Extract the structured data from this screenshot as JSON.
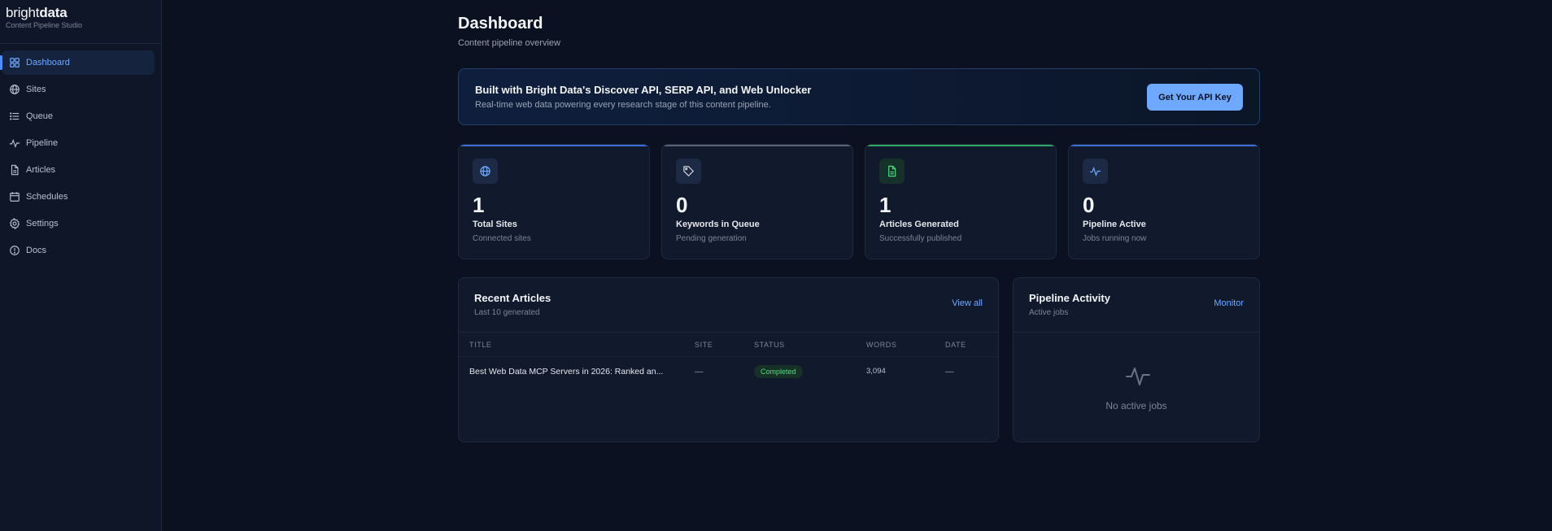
{
  "brand": {
    "logo_light": "bright",
    "logo_bold": "data",
    "subtitle": "Content Pipeline Studio"
  },
  "sidebar": {
    "items": [
      {
        "label": "Dashboard",
        "icon": "grid-icon",
        "active": true
      },
      {
        "label": "Sites",
        "icon": "globe-icon"
      },
      {
        "label": "Queue",
        "icon": "list-icon"
      },
      {
        "label": "Pipeline",
        "icon": "activity-icon"
      },
      {
        "label": "Articles",
        "icon": "file-icon"
      },
      {
        "label": "Schedules",
        "icon": "calendar-icon"
      },
      {
        "label": "Settings",
        "icon": "gear-icon"
      },
      {
        "label": "Docs",
        "icon": "info-icon"
      }
    ]
  },
  "header": {
    "title": "Dashboard",
    "subtitle": "Content pipeline overview"
  },
  "banner": {
    "title": "Built with Bright Data's Discover API, SERP API, and Web Unlocker",
    "text": "Real-time web data powering every research stage of this content pipeline.",
    "button_label": "Get Your API Key"
  },
  "stats": [
    {
      "value": "1",
      "label": "Total Sites",
      "sub": "Connected sites",
      "icon": "globe-icon",
      "accent": "#3b6fd6",
      "icon_color": "#6ea8ff"
    },
    {
      "value": "0",
      "label": "Keywords in Queue",
      "sub": "Pending generation",
      "icon": "tag-icon",
      "accent": "#5b6475",
      "icon_color": "#d1d5db"
    },
    {
      "value": "1",
      "label": "Articles Generated",
      "sub": "Successfully published",
      "icon": "file-icon",
      "accent": "#2fa864",
      "icon_color": "#4ade80"
    },
    {
      "value": "0",
      "label": "Pipeline Active",
      "sub": "Jobs running now",
      "icon": "activity-icon",
      "accent": "#3b6fd6",
      "icon_color": "#6ea8ff"
    }
  ],
  "recent_articles": {
    "title": "Recent Articles",
    "subtitle": "Last 10 generated",
    "link_label": "View all",
    "columns": [
      "TITLE",
      "SITE",
      "STATUS",
      "WORDS",
      "DATE"
    ],
    "rows": [
      {
        "title": "Best Web Data MCP Servers in 2026: Ranked an...",
        "site": "—",
        "status": "Completed",
        "words": "3,094",
        "date": "—"
      }
    ]
  },
  "pipeline_activity": {
    "title": "Pipeline Activity",
    "subtitle": "Active jobs",
    "link_label": "Monitor",
    "empty_text": "No active jobs"
  }
}
